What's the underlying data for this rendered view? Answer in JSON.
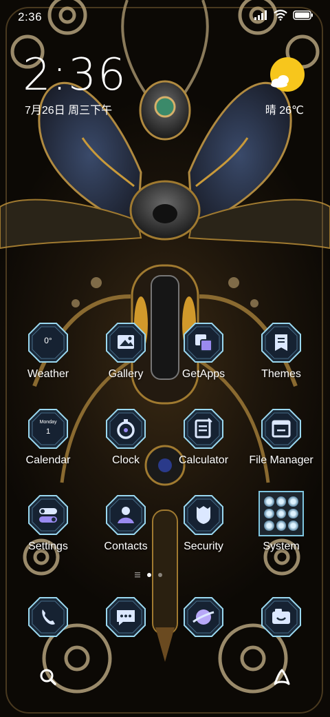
{
  "status_bar": {
    "time": "2:36",
    "battery": "battery-full"
  },
  "clock_widget": {
    "time": "2:36",
    "date": "7月26日 周三下午"
  },
  "weather_widget": {
    "text": "晴 26℃",
    "icon": "sun-cloud-icon",
    "sun_color": "#f7c61c"
  },
  "apps": [
    {
      "label": "Weather",
      "glyph": "0°"
    },
    {
      "label": "Gallery"
    },
    {
      "label": "GetApps"
    },
    {
      "label": "Themes"
    },
    {
      "label": "Calendar",
      "glyph_top": "Monday",
      "glyph_num": "1"
    },
    {
      "label": "Clock"
    },
    {
      "label": "Calculator"
    },
    {
      "label": "File Manager"
    },
    {
      "label": "Settings"
    },
    {
      "label": "Contacts"
    },
    {
      "label": "Security"
    },
    {
      "label": "System"
    }
  ],
  "page_indicator": {
    "pages": 2,
    "current": 1
  },
  "dock": [
    {
      "name": "phone",
      "icon": "phone-icon"
    },
    {
      "name": "messages",
      "icon": "chat-icon"
    },
    {
      "name": "browser",
      "icon": "planet-icon"
    },
    {
      "name": "camera",
      "icon": "camera-icon"
    }
  ],
  "bottom_bar": {
    "left": "search-icon",
    "right": "assistant-icon"
  },
  "colors": {
    "icon_border": "#9ad8f0",
    "icon_fill": "#1b2a3a",
    "icon_glyph": "#dce8ff",
    "accent_purple": "#9a8af0"
  }
}
